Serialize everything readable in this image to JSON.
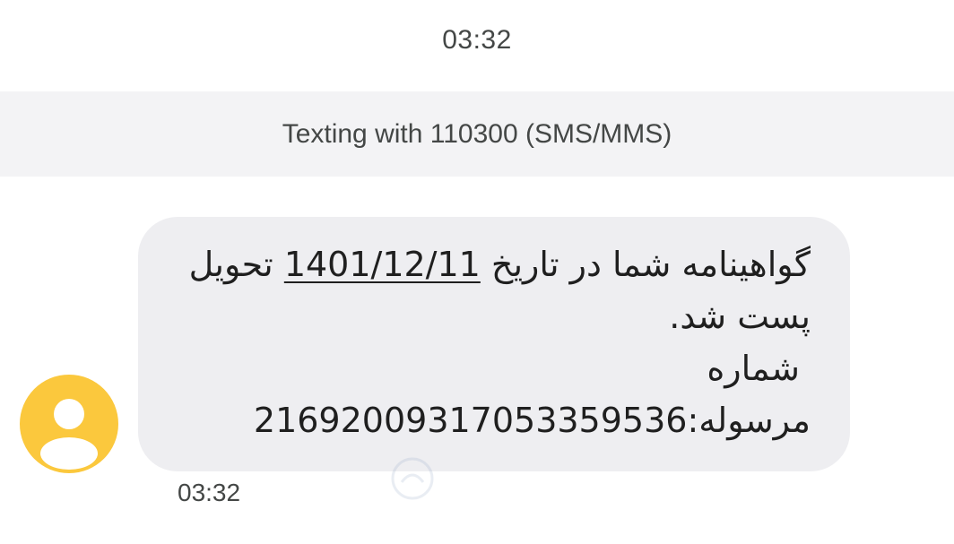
{
  "header": {
    "time": "03:32"
  },
  "banner": {
    "text": "Texting with 110300 (SMS/MMS)"
  },
  "message": {
    "line1_before": "گواهینامه شما در تاریخ ",
    "line1_date": "1401/12/11",
    "line1_after": " تحویل",
    "line2": "پست شد.",
    "line3": "شماره",
    "line4": "مرسوله:216920093170533595‎36"
  },
  "message_clean": {
    "line4": "مرسوله:2169200931705335953‎6"
  },
  "message_time": "03:32",
  "avatar": {
    "icon": "person-icon",
    "color": "#fbc83d"
  }
}
